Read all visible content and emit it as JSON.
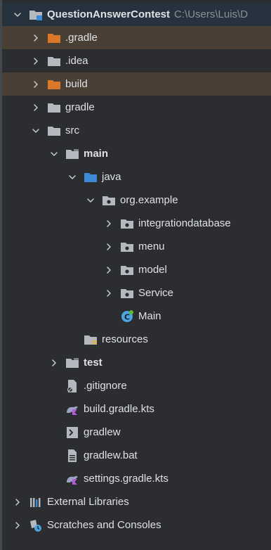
{
  "project": {
    "name": "QuestionAnswerContest",
    "path": "C:\\Users\\Luis\\D"
  },
  "tree": [
    {
      "id": "root",
      "label": "QuestionAnswerContest",
      "depth": 0,
      "chevron": "down",
      "icon": "module-folder-icon",
      "bold": true,
      "selected": "top"
    },
    {
      "id": "gradle-hidden",
      "label": ".gradle",
      "depth": 1,
      "chevron": "right",
      "icon": "excluded-folder-icon",
      "selected": "warm"
    },
    {
      "id": "idea",
      "label": ".idea",
      "depth": 1,
      "chevron": "right",
      "icon": "folder-icon"
    },
    {
      "id": "build",
      "label": "build",
      "depth": 1,
      "chevron": "right",
      "icon": "excluded-folder-icon",
      "selected": "warm"
    },
    {
      "id": "gradle",
      "label": "gradle",
      "depth": 1,
      "chevron": "right",
      "icon": "folder-icon"
    },
    {
      "id": "src",
      "label": "src",
      "depth": 1,
      "chevron": "down",
      "icon": "folder-icon"
    },
    {
      "id": "main",
      "label": "main",
      "depth": 2,
      "chevron": "down",
      "icon": "source-set-folder-icon",
      "bold": true
    },
    {
      "id": "java",
      "label": "java",
      "depth": 3,
      "chevron": "down",
      "icon": "source-root-folder-icon"
    },
    {
      "id": "org-example",
      "label": "org.example",
      "depth": 4,
      "chevron": "down",
      "icon": "package-icon"
    },
    {
      "id": "integrationdatabase",
      "label": "integrationdatabase",
      "depth": 5,
      "chevron": "right",
      "icon": "package-icon"
    },
    {
      "id": "menu",
      "label": "menu",
      "depth": 5,
      "chevron": "right",
      "icon": "package-icon"
    },
    {
      "id": "model",
      "label": "model",
      "depth": 5,
      "chevron": "right",
      "icon": "package-icon"
    },
    {
      "id": "service",
      "label": "Service",
      "depth": 5,
      "chevron": "right",
      "icon": "package-icon"
    },
    {
      "id": "main-class",
      "label": "Main",
      "depth": 5,
      "chevron": "none",
      "icon": "java-class-icon"
    },
    {
      "id": "resources",
      "label": "resources",
      "depth": 3,
      "chevron": "none",
      "icon": "resources-folder-icon"
    },
    {
      "id": "test",
      "label": "test",
      "depth": 2,
      "chevron": "right",
      "icon": "source-set-folder-icon",
      "bold": true
    },
    {
      "id": "gitignore",
      "label": ".gitignore",
      "depth": 2,
      "chevron": "none",
      "icon": "ignore-file-icon"
    },
    {
      "id": "build-gradle-kts",
      "label": "build.gradle.kts",
      "depth": 2,
      "chevron": "none",
      "icon": "gradle-kts-icon"
    },
    {
      "id": "gradlew",
      "label": "gradlew",
      "depth": 2,
      "chevron": "none",
      "icon": "shell-script-icon"
    },
    {
      "id": "gradlew-bat",
      "label": "gradlew.bat",
      "depth": 2,
      "chevron": "none",
      "icon": "text-file-icon"
    },
    {
      "id": "settings-gradle-kts",
      "label": "settings.gradle.kts",
      "depth": 2,
      "chevron": "none",
      "icon": "gradle-kts-icon"
    },
    {
      "id": "external-libraries",
      "label": "External Libraries",
      "depth": 0,
      "chevron": "right",
      "icon": "libraries-icon"
    },
    {
      "id": "scratches",
      "label": "Scratches and Consoles",
      "depth": 0,
      "chevron": "right",
      "icon": "scratches-icon"
    }
  ],
  "colors": {
    "background": "#2b2d30",
    "text": "#dfe1e5",
    "selected_warm": "#4a3f35",
    "selected_top": "#26333f",
    "folder": "#b4b8bf",
    "excluded_folder": "#d9782b",
    "source_root": "#3d8ad6",
    "java_class": "#4aa5e0",
    "gradle": "#9aa4c2",
    "gradle_accent": "#b65ad9"
  }
}
